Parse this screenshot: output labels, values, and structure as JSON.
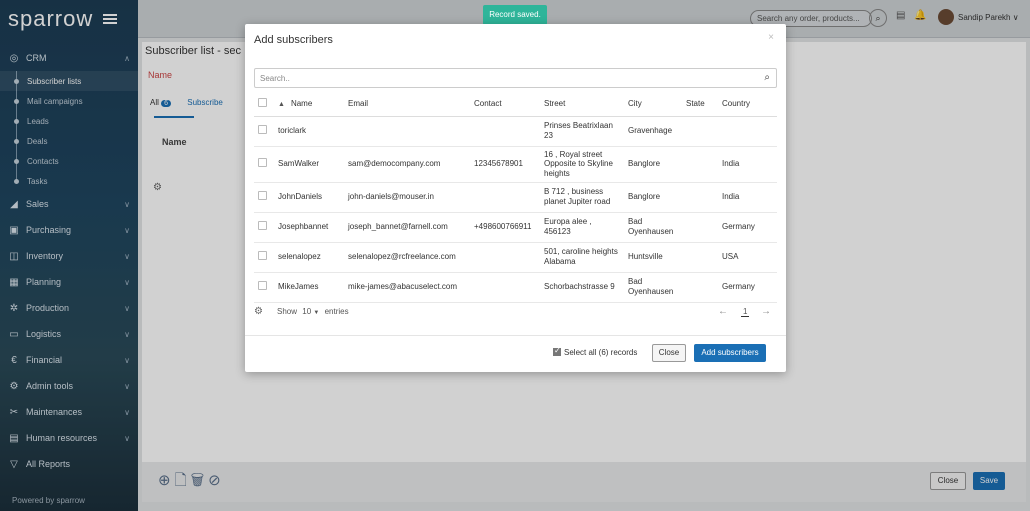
{
  "app": {
    "logo": "sparrow"
  },
  "sidebar": {
    "crm": {
      "label": "CRM",
      "icon": "chat-icon"
    },
    "crm_items": [
      "Subscriber lists",
      "Mail campaigns",
      "Leads",
      "Deals",
      "Contacts",
      "Tasks"
    ],
    "sections": [
      {
        "label": "Sales",
        "icon": "chart-icon"
      },
      {
        "label": "Purchasing",
        "icon": "cart-icon"
      },
      {
        "label": "Inventory",
        "icon": "box-icon"
      },
      {
        "label": "Planning",
        "icon": "calendar-icon"
      },
      {
        "label": "Production",
        "icon": "gear-icon"
      },
      {
        "label": "Logistics",
        "icon": "truck-icon"
      },
      {
        "label": "Financial",
        "icon": "euro-icon"
      },
      {
        "label": "Admin tools",
        "icon": "settings-icon"
      },
      {
        "label": "Maintenances",
        "icon": "wrench-icon"
      },
      {
        "label": "Human resources",
        "icon": "id-card-icon"
      },
      {
        "label": "All Reports",
        "icon": "filter-icon"
      }
    ],
    "powered_by": "Powered by sparrow"
  },
  "topbar": {
    "search_placeholder": "Search any order, products...",
    "user_name": "Sandip Parekh"
  },
  "background": {
    "page_title": "Subscriber list - sec",
    "name_label": "Name",
    "tab_all": "All",
    "tab_all_count": "6",
    "tab_subscribers": "Subscribe",
    "col_name": "Name",
    "close_label": "Close",
    "save_label": "Save"
  },
  "toast": {
    "text": "Record saved."
  },
  "modal": {
    "title": "Add subscribers",
    "close_x": "×",
    "search_placeholder": "Search..",
    "columns": [
      "Name",
      "Email",
      "Contact",
      "Street",
      "City",
      "State",
      "Country"
    ],
    "rows": [
      {
        "name": "toriclark",
        "email": "",
        "contact": "",
        "street": "Prinses Beatrixlaan 23",
        "city": "Gravenhage",
        "state": "",
        "country": ""
      },
      {
        "name": "SamWalker",
        "email": "sam@democompany.com",
        "contact": "12345678901",
        "street": "16 , Royal street Opposite to Skyline heights",
        "city": "Banglore",
        "state": "",
        "country": "India"
      },
      {
        "name": "JohnDaniels",
        "email": "john-daniels@mouser.in",
        "contact": "",
        "street": "B 712 , business planet Jupiter road",
        "city": "Banglore",
        "state": "",
        "country": "India"
      },
      {
        "name": "Josephbannet",
        "email": "joseph_bannet@farnell.com",
        "contact": "+498600766911",
        "street": "Europa alee , 456123",
        "city": "Bad Oyenhausen",
        "state": "",
        "country": "Germany"
      },
      {
        "name": "selenalopez",
        "email": "selenalopez@rcfreelance.com",
        "contact": "",
        "street": "501, caroline heights Alabama",
        "city": "Huntsville",
        "state": "",
        "country": "USA"
      },
      {
        "name": "MikeJames",
        "email": "mike-james@abacuselect.com",
        "contact": "",
        "street": "Schorbachstrasse 9",
        "city": "Bad Oyenhausen",
        "state": "",
        "country": "Germany"
      }
    ],
    "show_label": "Show",
    "entries_value": "10",
    "entries_label": "entries",
    "page_current": "1",
    "prev_arrow": "←",
    "next_arrow": "→",
    "select_all_label": "Select all (6) records",
    "close_button": "Close",
    "add_button": "Add subscribers"
  },
  "colors": {
    "accent": "#1a6fb5",
    "toast": "#2fb59a",
    "sidebar": "#1f4660"
  }
}
